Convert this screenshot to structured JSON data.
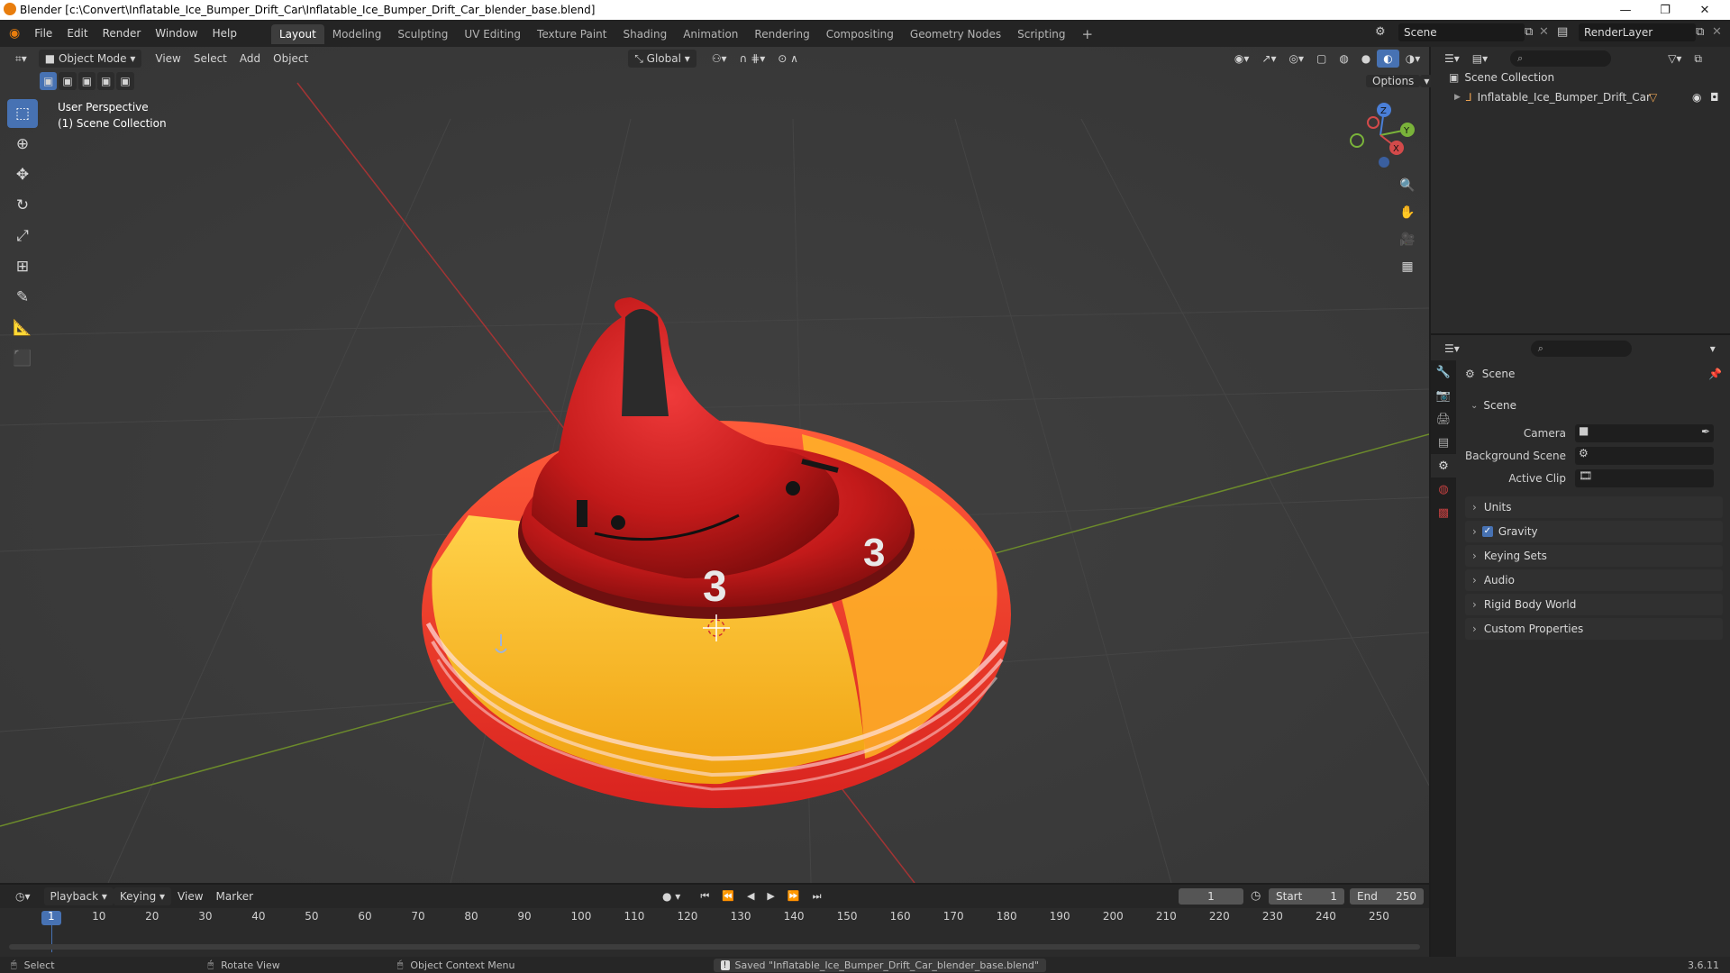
{
  "window": {
    "title": "Blender [c:\\Convert\\Inflatable_Ice_Bumper_Drift_Car\\Inflatable_Ice_Bumper_Drift_Car_blender_base.blend]"
  },
  "menu": [
    "File",
    "Edit",
    "Render",
    "Window",
    "Help"
  ],
  "workspaces": [
    "Layout",
    "Modeling",
    "Sculpting",
    "UV Editing",
    "Texture Paint",
    "Shading",
    "Animation",
    "Rendering",
    "Compositing",
    "Geometry Nodes",
    "Scripting"
  ],
  "active_workspace": "Layout",
  "scene_name": "Scene",
  "view_layer": "RenderLayer",
  "viewport": {
    "mode": "Object Mode",
    "menus": [
      "View",
      "Select",
      "Add",
      "Object"
    ],
    "orientation": "Global",
    "options_label": "Options",
    "perspective_label": "User Perspective",
    "collection_label": "(1) Scene Collection",
    "gizmo_axes": [
      "Z",
      "Y",
      "X"
    ],
    "model_number": "3"
  },
  "outliner": {
    "root": "Scene Collection",
    "items": [
      {
        "label": "Inflatable_Ice_Bumper_Drift_Car"
      }
    ]
  },
  "properties": {
    "header": "Scene",
    "panel_title": "Scene",
    "fields": [
      {
        "label": "Camera",
        "value": ""
      },
      {
        "label": "Background Scene",
        "value": ""
      },
      {
        "label": "Active Clip",
        "value": ""
      }
    ],
    "sections": [
      "Units",
      "Gravity",
      "Keying Sets",
      "Audio",
      "Rigid Body World",
      "Custom Properties"
    ],
    "gravity_checked": true
  },
  "timeline": {
    "menus": [
      "Playback",
      "Keying",
      "View",
      "Marker"
    ],
    "current_frame": "1",
    "start_label": "Start",
    "start": "1",
    "end_label": "End",
    "end": "250",
    "ticks": [
      "1",
      "10",
      "20",
      "30",
      "40",
      "50",
      "60",
      "70",
      "80",
      "90",
      "100",
      "110",
      "120",
      "130",
      "140",
      "150",
      "160",
      "170",
      "180",
      "190",
      "200",
      "210",
      "220",
      "230",
      "240",
      "250"
    ]
  },
  "statusbar": {
    "select": "Select",
    "rotate": "Rotate View",
    "context": "Object Context Menu",
    "message": "Saved \"Inflatable_Ice_Bumper_Drift_Car_blender_base.blend\"",
    "version": "3.6.11"
  }
}
